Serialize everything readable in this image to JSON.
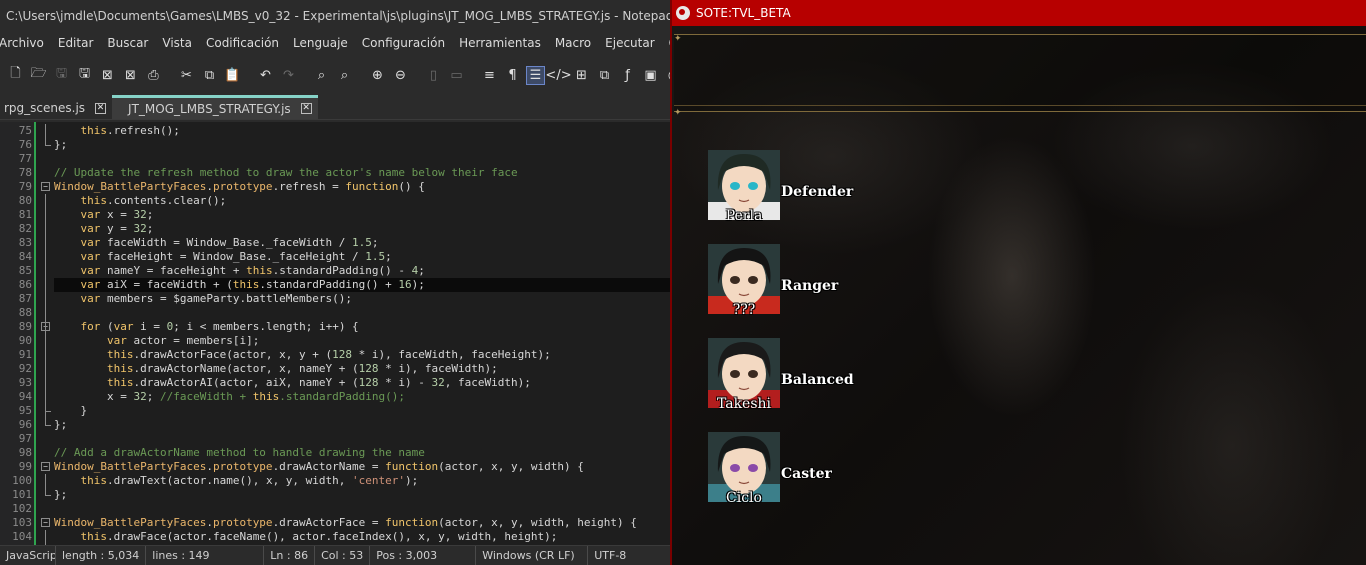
{
  "npp": {
    "title": "C:\\Users\\jmdle\\Documents\\Games\\LMBS_v0_32 - Experimental\\js\\plugins\\JT_MOG_LMBS_STRATEGY.js - Notepad++",
    "menu": [
      "Archivo",
      "Editar",
      "Buscar",
      "Vista",
      "Codificación",
      "Lenguaje",
      "Configuración",
      "Herramientas",
      "Macro",
      "Ejecutar",
      "Complementos"
    ],
    "tabs": [
      {
        "label": "rpg_scenes.js",
        "active": false
      },
      {
        "label": "JT_MOG_LMBS_STRATEGY.js",
        "active": true
      }
    ],
    "lines": [
      {
        "n": "75",
        "code": "    this.refresh();"
      },
      {
        "n": "76",
        "code": "};"
      },
      {
        "n": "77",
        "code": ""
      },
      {
        "n": "78",
        "code": "// Update the refresh method to draw the actor's name below their face"
      },
      {
        "n": "79",
        "code": "Window_BattlePartyFaces.prototype.refresh = function() {"
      },
      {
        "n": "80",
        "code": "    this.contents.clear();"
      },
      {
        "n": "81",
        "code": "    var x = 32;"
      },
      {
        "n": "82",
        "code": "    var y = 32;"
      },
      {
        "n": "83",
        "code": "    var faceWidth = Window_Base._faceWidth / 1.5;"
      },
      {
        "n": "84",
        "code": "    var faceHeight = Window_Base._faceHeight / 1.5;"
      },
      {
        "n": "85",
        "code": "    var nameY = faceHeight + this.standardPadding() - 4;"
      },
      {
        "n": "86",
        "code": "    var aiX = faceWidth + (this.standardPadding() + 16);"
      },
      {
        "n": "87",
        "code": "    var members = $gameParty.battleMembers();"
      },
      {
        "n": "88",
        "code": ""
      },
      {
        "n": "89",
        "code": "    for (var i = 0; i < members.length; i++) {"
      },
      {
        "n": "90",
        "code": "        var actor = members[i];"
      },
      {
        "n": "91",
        "code": "        this.drawActorFace(actor, x, y + (128 * i), faceWidth, faceHeight);"
      },
      {
        "n": "92",
        "code": "        this.drawActorName(actor, x, nameY + (128 * i), faceWidth);"
      },
      {
        "n": "93",
        "code": "        this.drawActorAI(actor, aiX, nameY + (128 * i) - 32, faceWidth);"
      },
      {
        "n": "94",
        "code": "        x = 32; //faceWidth + this.standardPadding();"
      },
      {
        "n": "95",
        "code": "    }"
      },
      {
        "n": "96",
        "code": "};"
      },
      {
        "n": "97",
        "code": ""
      },
      {
        "n": "98",
        "code": "// Add a drawActorName method to handle drawing the name"
      },
      {
        "n": "99",
        "code": "Window_BattlePartyFaces.prototype.drawActorName = function(actor, x, y, width) {"
      },
      {
        "n": "100",
        "code": "    this.drawText(actor.name(), x, y, width, 'center');"
      },
      {
        "n": "101",
        "code": "};"
      },
      {
        "n": "102",
        "code": ""
      },
      {
        "n": "103",
        "code": "Window_BattlePartyFaces.prototype.drawActorFace = function(actor, x, y, width, height) {"
      },
      {
        "n": "104",
        "code": "    this.drawFace(actor.faceName(), actor.faceIndex(), x, y, width, height);"
      }
    ],
    "highlight_line": "86",
    "status": {
      "type": "JavaScript file",
      "length": "length : 5,034",
      "lines": "lines : 149",
      "ln": "Ln : 86",
      "col": "Col : 53",
      "pos": "Pos : 3,003",
      "eol": "Windows (CR LF)",
      "enc": "UTF-8"
    }
  },
  "game": {
    "title": "SOTE:TVL_BETA",
    "party": [
      {
        "name": "Perla",
        "ai": "Defender",
        "hair": "#1f2a24",
        "eyes": "#28b6c8",
        "clothes": "#e8e8e8"
      },
      {
        "name": "???",
        "ai": "Ranger",
        "hair": "#141414",
        "eyes": "#3a2a20",
        "clothes": "#c82a1e"
      },
      {
        "name": "Takeshi",
        "ai": "Balanced",
        "hair": "#1a1a1a",
        "eyes": "#3a2a20",
        "clothes": "#b31e1e"
      },
      {
        "name": "Ciclo",
        "ai": "Caster",
        "hair": "#151818",
        "eyes": "#8a4aa8",
        "clothes": "#3c7f8a"
      }
    ]
  }
}
